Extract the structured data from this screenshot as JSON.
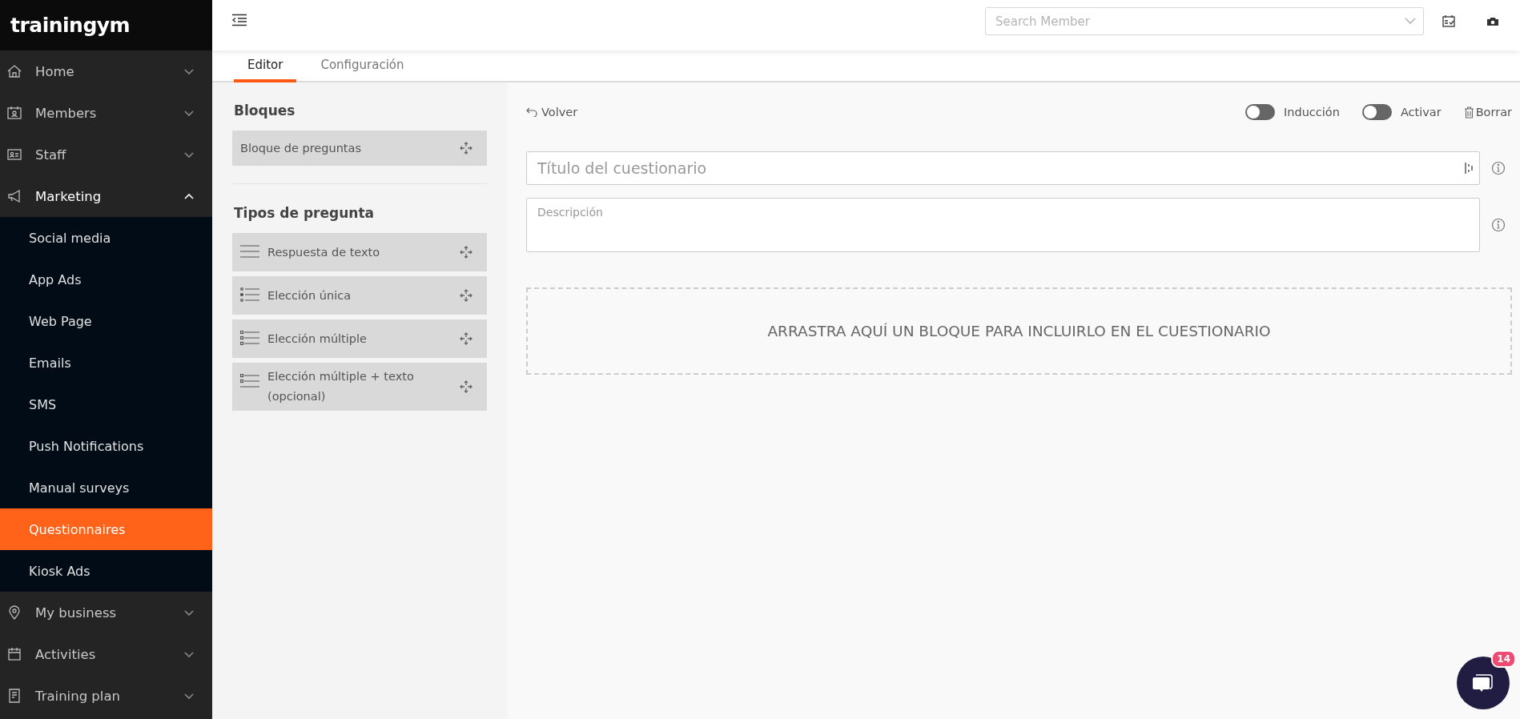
{
  "sidebar": {
    "logo": "trainingym",
    "items": [
      {
        "label": "Home",
        "kind": "home",
        "expanded": false
      },
      {
        "label": "Members",
        "kind": "members",
        "expanded": false
      },
      {
        "label": "Staff",
        "kind": "staff",
        "expanded": false
      },
      {
        "label": "Marketing",
        "kind": "marketing",
        "expanded": true,
        "children": [
          {
            "label": "Social media",
            "selected": false
          },
          {
            "label": "App Ads",
            "selected": false
          },
          {
            "label": "Web Page",
            "selected": false
          },
          {
            "label": "Emails",
            "selected": false
          },
          {
            "label": "SMS",
            "selected": false
          },
          {
            "label": "Push Notifications",
            "selected": false
          },
          {
            "label": "Manual surveys",
            "selected": false
          },
          {
            "label": "Questionnaires",
            "selected": true
          },
          {
            "label": "Kiosk Ads",
            "selected": false
          }
        ]
      },
      {
        "label": "My business",
        "kind": "business",
        "expanded": false
      },
      {
        "label": "Activities",
        "kind": "activities",
        "expanded": false
      },
      {
        "label": "Training plan",
        "kind": "training",
        "expanded": false
      }
    ]
  },
  "topbar": {
    "search": {
      "placeholder": "Search Member"
    }
  },
  "tabs": [
    {
      "label": "Editor",
      "selected": true
    },
    {
      "label": "Configuración",
      "selected": false
    }
  ],
  "palette": {
    "blocks_title": "Bloques",
    "blocks": [
      {
        "label": "Bloque de preguntas"
      }
    ],
    "types_title": "Tipos de pregunta",
    "types": [
      {
        "label": "Respuesta de texto",
        "kind": "text"
      },
      {
        "label": "Elección única",
        "kind": "single"
      },
      {
        "label": "Elección múltiple",
        "kind": "multiple"
      },
      {
        "label": "Elección múltiple + texto (opcional)",
        "kind": "multiple_text"
      }
    ]
  },
  "editor": {
    "back": "Volver",
    "toggles": [
      {
        "label": "Inducción",
        "on": false
      },
      {
        "label": "Activar",
        "on": false
      }
    ],
    "delete": "Borrar",
    "title_field": {
      "placeholder": "Título del cuestionario"
    },
    "description_field": {
      "placeholder": "Descripción"
    },
    "dropzone": "ARRASTRA AQUÍ UN BLOQUE PARA INCLUIRLO EN EL CUESTIONARIO"
  },
  "chat": {
    "badge": "14"
  }
}
